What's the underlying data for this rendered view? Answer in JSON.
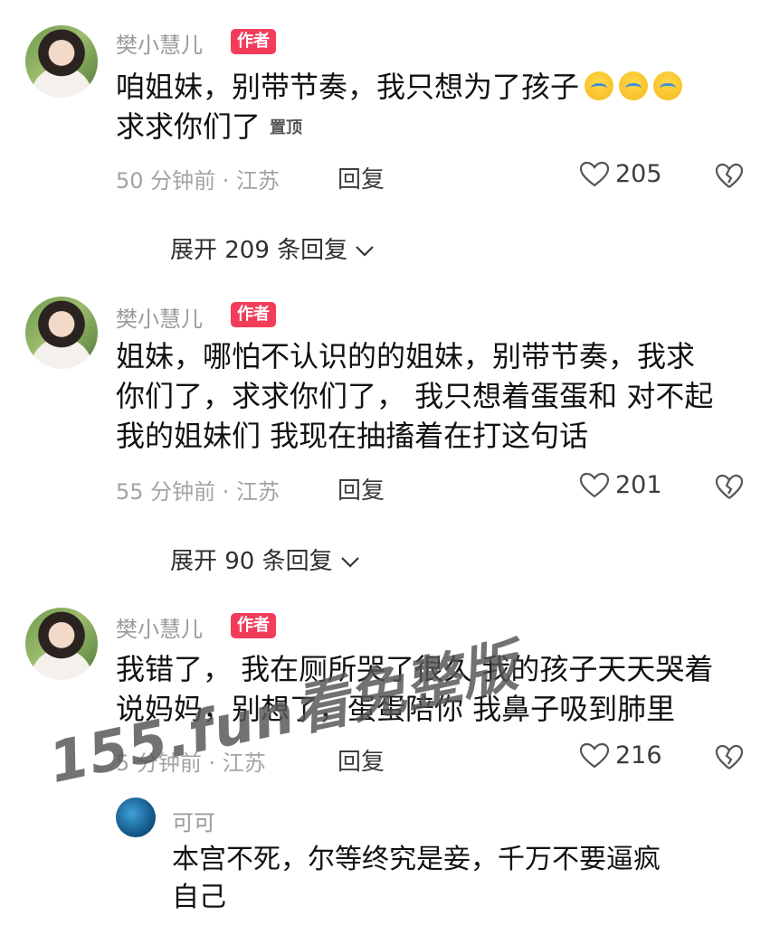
{
  "comments": [
    {
      "username": "樊小慧儿",
      "badge": "作者",
      "text_line1": "咱姐妹，别带节奏，我只想为了孩子",
      "text_line2": "求求你们了",
      "pinned_label": "置顶",
      "time_location": "50 分钟前 · 江苏",
      "reply_label": "回复",
      "likes": "205",
      "expand_label": "展开 209 条回复"
    },
    {
      "username": "樊小慧儿",
      "badge": "作者",
      "text_line1": "姐妹，哪怕不认识的的姐妹，别带节奏，我求",
      "text_line2": "你们了，求求你们了， 我只想着蛋蛋和 对不起",
      "text_line3": "我的姐妹们 我现在抽搐着在打这句话",
      "time_location": "55 分钟前 · 江苏",
      "reply_label": "回复",
      "likes": "201",
      "expand_label": "展开 90 条回复"
    },
    {
      "username": "樊小慧儿",
      "badge": "作者",
      "text_line1": "我错了， 我在厕所哭了很久 我的孩子天天哭着",
      "text_line2": "说妈妈，别想了，蛋蛋陪你 我鼻子吸到肺里",
      "time_location": "5 分钟前 · 江苏",
      "reply_label": "回复",
      "likes": "216"
    }
  ],
  "sub_reply": {
    "username": "可可",
    "text_line1": "本宫不死，尔等终究是妾，千万不要逼疯",
    "text_line2": "自己"
  },
  "watermark": "155.fun看免整版",
  "icons": {
    "like": "heart-outline-icon",
    "dislike": "broken-heart-icon",
    "expand": "chevron-down-icon",
    "emoji": "crying-face-emoji"
  },
  "colors": {
    "badge": "#f23d5a",
    "meta": "#a3a3a3"
  }
}
